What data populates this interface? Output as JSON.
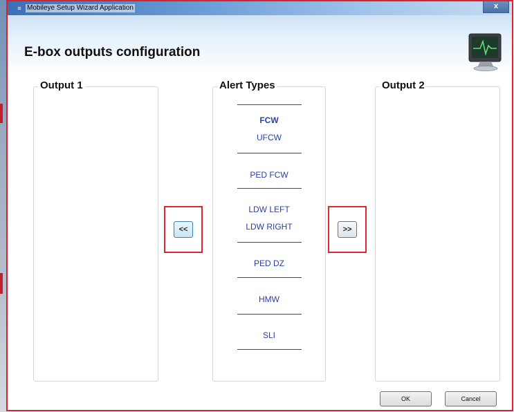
{
  "window": {
    "title": "Mobileye Setup Wizard Application",
    "app_icon": "mobileye-app-icon",
    "close_label": "x"
  },
  "header": {
    "title": "E-box outputs configuration",
    "icon": "monitor-heartbeat-icon"
  },
  "output1": {
    "title": "Output 1",
    "items": []
  },
  "alert_types": {
    "title": "Alert Types",
    "groups": [
      [
        {
          "label": "FCW",
          "bold": true
        },
        {
          "label": "UFCW",
          "bold": false
        }
      ],
      [
        {
          "label": "PED FCW",
          "bold": false
        }
      ],
      [
        {
          "label": "LDW LEFT",
          "bold": false
        },
        {
          "label": "LDW RIGHT",
          "bold": false
        }
      ],
      [
        {
          "label": "PED DZ",
          "bold": false
        }
      ],
      [
        {
          "label": "HMW",
          "bold": false
        }
      ],
      [
        {
          "label": "SLI",
          "bold": false
        }
      ]
    ]
  },
  "output2": {
    "title": "Output 2",
    "items": []
  },
  "buttons": {
    "move_left": "<<",
    "move_right": ">>",
    "ok": "OK",
    "cancel": "Cancel"
  },
  "colors": {
    "highlight_box": "#e0262e",
    "item_text": "#2b3fa0",
    "window_border": "#d9232b"
  }
}
